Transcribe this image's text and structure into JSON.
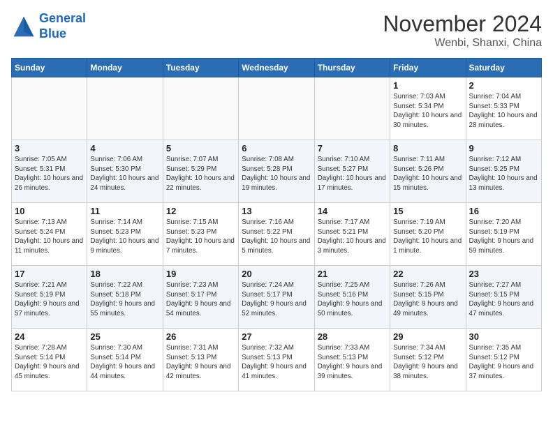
{
  "header": {
    "logo_line1": "General",
    "logo_line2": "Blue",
    "month": "November 2024",
    "location": "Wenbi, Shanxi, China"
  },
  "days_of_week": [
    "Sunday",
    "Monday",
    "Tuesday",
    "Wednesday",
    "Thursday",
    "Friday",
    "Saturday"
  ],
  "weeks": [
    [
      {
        "day": "",
        "info": ""
      },
      {
        "day": "",
        "info": ""
      },
      {
        "day": "",
        "info": ""
      },
      {
        "day": "",
        "info": ""
      },
      {
        "day": "",
        "info": ""
      },
      {
        "day": "1",
        "info": "Sunrise: 7:03 AM\nSunset: 5:34 PM\nDaylight: 10 hours and 30 minutes."
      },
      {
        "day": "2",
        "info": "Sunrise: 7:04 AM\nSunset: 5:33 PM\nDaylight: 10 hours and 28 minutes."
      }
    ],
    [
      {
        "day": "3",
        "info": "Sunrise: 7:05 AM\nSunset: 5:31 PM\nDaylight: 10 hours and 26 minutes."
      },
      {
        "day": "4",
        "info": "Sunrise: 7:06 AM\nSunset: 5:30 PM\nDaylight: 10 hours and 24 minutes."
      },
      {
        "day": "5",
        "info": "Sunrise: 7:07 AM\nSunset: 5:29 PM\nDaylight: 10 hours and 22 minutes."
      },
      {
        "day": "6",
        "info": "Sunrise: 7:08 AM\nSunset: 5:28 PM\nDaylight: 10 hours and 19 minutes."
      },
      {
        "day": "7",
        "info": "Sunrise: 7:10 AM\nSunset: 5:27 PM\nDaylight: 10 hours and 17 minutes."
      },
      {
        "day": "8",
        "info": "Sunrise: 7:11 AM\nSunset: 5:26 PM\nDaylight: 10 hours and 15 minutes."
      },
      {
        "day": "9",
        "info": "Sunrise: 7:12 AM\nSunset: 5:25 PM\nDaylight: 10 hours and 13 minutes."
      }
    ],
    [
      {
        "day": "10",
        "info": "Sunrise: 7:13 AM\nSunset: 5:24 PM\nDaylight: 10 hours and 11 minutes."
      },
      {
        "day": "11",
        "info": "Sunrise: 7:14 AM\nSunset: 5:23 PM\nDaylight: 10 hours and 9 minutes."
      },
      {
        "day": "12",
        "info": "Sunrise: 7:15 AM\nSunset: 5:23 PM\nDaylight: 10 hours and 7 minutes."
      },
      {
        "day": "13",
        "info": "Sunrise: 7:16 AM\nSunset: 5:22 PM\nDaylight: 10 hours and 5 minutes."
      },
      {
        "day": "14",
        "info": "Sunrise: 7:17 AM\nSunset: 5:21 PM\nDaylight: 10 hours and 3 minutes."
      },
      {
        "day": "15",
        "info": "Sunrise: 7:19 AM\nSunset: 5:20 PM\nDaylight: 10 hours and 1 minute."
      },
      {
        "day": "16",
        "info": "Sunrise: 7:20 AM\nSunset: 5:19 PM\nDaylight: 9 hours and 59 minutes."
      }
    ],
    [
      {
        "day": "17",
        "info": "Sunrise: 7:21 AM\nSunset: 5:19 PM\nDaylight: 9 hours and 57 minutes."
      },
      {
        "day": "18",
        "info": "Sunrise: 7:22 AM\nSunset: 5:18 PM\nDaylight: 9 hours and 55 minutes."
      },
      {
        "day": "19",
        "info": "Sunrise: 7:23 AM\nSunset: 5:17 PM\nDaylight: 9 hours and 54 minutes."
      },
      {
        "day": "20",
        "info": "Sunrise: 7:24 AM\nSunset: 5:17 PM\nDaylight: 9 hours and 52 minutes."
      },
      {
        "day": "21",
        "info": "Sunrise: 7:25 AM\nSunset: 5:16 PM\nDaylight: 9 hours and 50 minutes."
      },
      {
        "day": "22",
        "info": "Sunrise: 7:26 AM\nSunset: 5:15 PM\nDaylight: 9 hours and 49 minutes."
      },
      {
        "day": "23",
        "info": "Sunrise: 7:27 AM\nSunset: 5:15 PM\nDaylight: 9 hours and 47 minutes."
      }
    ],
    [
      {
        "day": "24",
        "info": "Sunrise: 7:28 AM\nSunset: 5:14 PM\nDaylight: 9 hours and 45 minutes."
      },
      {
        "day": "25",
        "info": "Sunrise: 7:30 AM\nSunset: 5:14 PM\nDaylight: 9 hours and 44 minutes."
      },
      {
        "day": "26",
        "info": "Sunrise: 7:31 AM\nSunset: 5:13 PM\nDaylight: 9 hours and 42 minutes."
      },
      {
        "day": "27",
        "info": "Sunrise: 7:32 AM\nSunset: 5:13 PM\nDaylight: 9 hours and 41 minutes."
      },
      {
        "day": "28",
        "info": "Sunrise: 7:33 AM\nSunset: 5:13 PM\nDaylight: 9 hours and 39 minutes."
      },
      {
        "day": "29",
        "info": "Sunrise: 7:34 AM\nSunset: 5:12 PM\nDaylight: 9 hours and 38 minutes."
      },
      {
        "day": "30",
        "info": "Sunrise: 7:35 AM\nSunset: 5:12 PM\nDaylight: 9 hours and 37 minutes."
      }
    ]
  ]
}
